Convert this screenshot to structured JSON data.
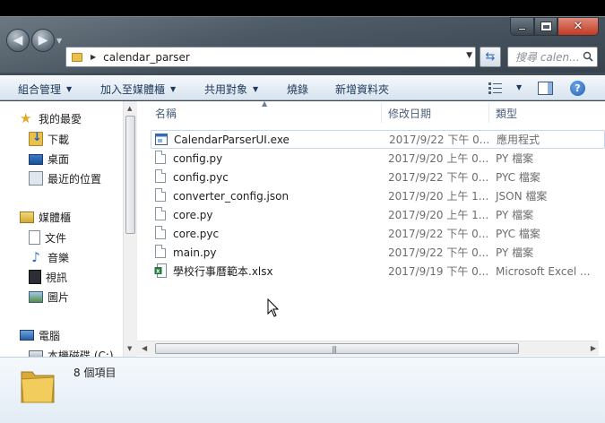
{
  "window": {
    "caption_buttons": {
      "minimize": "",
      "maximize": "",
      "close": "✕"
    }
  },
  "address_bar": {
    "path": "calendar_parser",
    "search_placeholder": "搜尋 calen..."
  },
  "command_bar": {
    "organize": "組合管理",
    "include_in_library": "加入至媒體櫃",
    "share_with": "共用對象",
    "burn": "燒錄",
    "new_folder": "新增資料夾"
  },
  "nav_pane": {
    "items": [
      {
        "label": "我的最愛",
        "icon": "star-icon"
      },
      {
        "label": "下載",
        "icon": "downloads-folder-icon"
      },
      {
        "label": "桌面",
        "icon": "desktop-icon"
      },
      {
        "label": "最近的位置",
        "icon": "recent-places-icon"
      },
      {
        "label": "媒體櫃",
        "icon": "libraries-icon"
      },
      {
        "label": "文件",
        "icon": "documents-icon"
      },
      {
        "label": "音樂",
        "icon": "music-icon"
      },
      {
        "label": "視訊",
        "icon": "videos-icon"
      },
      {
        "label": "圖片",
        "icon": "pictures-icon"
      },
      {
        "label": "電腦",
        "icon": "computer-icon"
      },
      {
        "label": "本機磁碟 (C:)",
        "icon": "local-disk-icon"
      }
    ]
  },
  "file_list": {
    "columns": {
      "name": "名稱",
      "date": "修改日期",
      "type": "類型"
    },
    "files": [
      {
        "name": "CalendarParserUI.exe",
        "date": "2017/9/22 下午 0...",
        "type": "應用程式",
        "icon": "exe-icon"
      },
      {
        "name": "config.py",
        "date": "2017/9/20 上午 0...",
        "type": "PY 檔案",
        "icon": "file-icon"
      },
      {
        "name": "config.pyc",
        "date": "2017/9/22 下午 0...",
        "type": "PYC 檔案",
        "icon": "file-icon"
      },
      {
        "name": "converter_config.json",
        "date": "2017/9/20 上午 1...",
        "type": "JSON 檔案",
        "icon": "file-icon"
      },
      {
        "name": "core.py",
        "date": "2017/9/20 上午 1...",
        "type": "PY 檔案",
        "icon": "file-icon"
      },
      {
        "name": "core.pyc",
        "date": "2017/9/22 下午 0...",
        "type": "PYC 檔案",
        "icon": "file-icon"
      },
      {
        "name": "main.py",
        "date": "2017/9/22 下午 0...",
        "type": "PY 檔案",
        "icon": "file-icon"
      },
      {
        "name": "學校行事曆範本.xlsx",
        "date": "2017/9/19 下午 0...",
        "type": "Microsoft Excel ...",
        "icon": "excel-icon"
      }
    ]
  },
  "details_pane": {
    "item_count": "8 個項目"
  },
  "colors": {
    "command_text": "#1e395b",
    "header_text": "#4c607a",
    "secondary_text": "#6d6d6d",
    "folder_yellow": "#e8c04a"
  }
}
